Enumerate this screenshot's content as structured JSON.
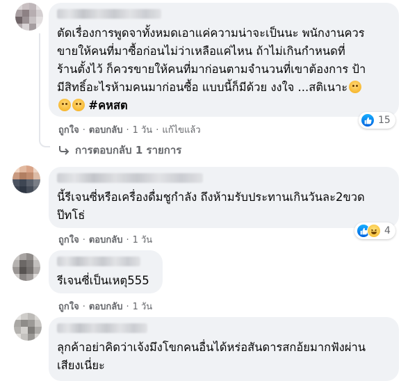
{
  "comments": [
    {
      "text": "ตัดเรื่องการพูดจาทั้งหมดเอาแค่ความน่าจะเป็นนะ พนักงานควร\nขายให้คนที่มาซื้อก่อนไม่ว่าเหลือแค่ไหน ถ้าไม่เกินกำหนดที่\nร้านตั้งไว้ ก็ควรขายให้คนที่มาก่อนตามจำนวนที่เขาต้องการ ป้า\nมีสิทธิ์อะไรห้ามคนมาก่อนซื้อ แบบนี้ก็มีด้วย งงใจ ...สติเนาะ",
      "hashtag": "#คหสต",
      "like": "ถูกใจ",
      "reply": "ตอบกลับ",
      "time": "1 วัน",
      "edited": "แก้ไขแล้ว",
      "reaction_count": "15",
      "reaction_icons": [
        "like-icon"
      ],
      "replies_label": "การตอบกลับ 1 รายการ",
      "avatar_colors": [
        "#d9d4d5",
        "#c9c0c2",
        "#bfb7ba",
        "#e6e2e3",
        "#a89ea1",
        "#8d8184",
        "#b7aeb1",
        "#d4cfd1",
        "#6f6467",
        "#9b9194",
        "#c7c1c3",
        "#e2dedf",
        "#b2aaad",
        "#d8d3d5",
        "#a59da0",
        "#ebe8e9"
      ]
    },
    {
      "text": "นี้รีเจนซี่หรือเครื่องดื่มชูกำลัง ถึงห้ามรับประทานเกินวันละ2ขวด\nป๊ทโธ่",
      "like": "ถูกใจ",
      "reply": "ตอบกลับ",
      "time": "1 วัน",
      "reaction_count": "4",
      "reaction_icons": [
        "like-icon",
        "haha-icon"
      ],
      "avatar_colors": [
        "#f1d5c2",
        "#e2b9a0",
        "#d9a488",
        "#ecd3c3",
        "#c99a80",
        "#b27f62",
        "#c08c6f",
        "#dcbba6",
        "#4c5360",
        "#3e4653",
        "#5a606b",
        "#7a7e86",
        "#3c4350",
        "#2f3744",
        "#454c58",
        "#6a6f78"
      ]
    },
    {
      "text": "รีเจนซี่เป็นเหตุ555",
      "like": "ถูกใจ",
      "reply": "ตอบกลับ",
      "time": "1 วัน",
      "avatar_colors": [
        "#c9c6c4",
        "#a8a4a2",
        "#8f8b89",
        "#d6d3d1",
        "#b5b2b0",
        "#6c6866",
        "#7d7977",
        "#c2bfbd",
        "#9a9694",
        "#585452",
        "#74706e",
        "#b0acaa",
        "#d0cdcb",
        "#8a8684",
        "#a19d9b",
        "#dedbd9"
      ]
    },
    {
      "text": "ลุกค้าอย่าคิดว่าเจ้งมึงโขกคนอื่นได้หร่อสันดารสกอ้ยมากฟังผ่าน\nเสียงเนี่ยะ",
      "avatar_colors": [
        "#e4e3e1",
        "#cfcdca",
        "#bdbbb8",
        "#d9d7d4",
        "#a9a7a4",
        "#8e8c89",
        "#9c9a97",
        "#c8c6c3",
        "#b4b2af",
        "#d3d1ce",
        "#7f7d7a",
        "#aeaca9",
        "#e0dedb",
        "#c4c2bf",
        "#9a9895",
        "#d6d4d1"
      ]
    }
  ],
  "colors": {
    "bubble": "#f0f2f5",
    "meta": "#65676b",
    "text": "#050505",
    "like_blue": "#1877f2"
  }
}
